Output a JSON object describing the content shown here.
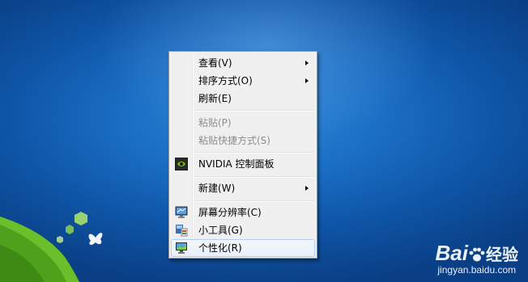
{
  "context_menu": {
    "items": [
      {
        "label": "查看(V)",
        "submenu": true,
        "enabled": true
      },
      {
        "label": "排序方式(O)",
        "submenu": true,
        "enabled": true
      },
      {
        "label": "刷新(E)",
        "submenu": false,
        "enabled": true
      },
      {
        "label": "粘贴(P)",
        "submenu": false,
        "enabled": false
      },
      {
        "label": "粘贴快捷方式(S)",
        "submenu": false,
        "enabled": false
      },
      {
        "label": "NVIDIA 控制面板",
        "submenu": false,
        "enabled": true,
        "icon": "nvidia-icon"
      },
      {
        "label": "新建(W)",
        "submenu": true,
        "enabled": true
      },
      {
        "label": "屏幕分辨率(C)",
        "submenu": false,
        "enabled": true,
        "icon": "monitor-icon"
      },
      {
        "label": "小工具(G)",
        "submenu": false,
        "enabled": true,
        "icon": "gadgets-icon"
      },
      {
        "label": "个性化(R)",
        "submenu": false,
        "enabled": true,
        "icon": "personalize-icon",
        "highlighted": true
      }
    ]
  },
  "watermark": {
    "logo_text": "Bai",
    "logo_text2": "经验",
    "site": "jingyan.baidu.com"
  },
  "colors": {
    "desktop_blue": "#1a6ec4",
    "menu_bg": "#f0f0f0",
    "highlight_border": "#aecff7",
    "nvidia_green": "#76b900"
  }
}
